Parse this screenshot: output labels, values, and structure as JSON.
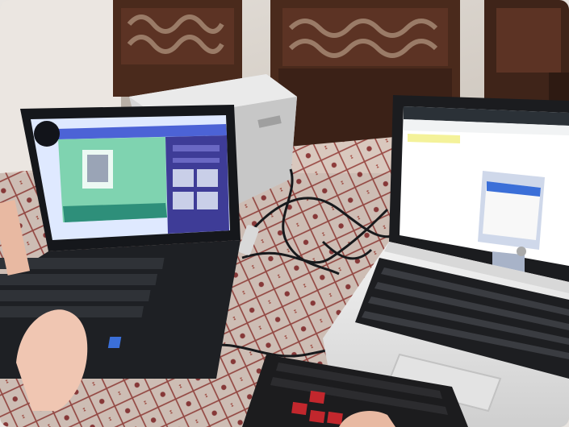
{
  "photo": {
    "scene": "photo",
    "colors": {
      "wall": "#d8d2cb",
      "chair_wood": "#4a2a1c",
      "tablecloth": "#d9c8be",
      "tablecloth_pattern": "#9a4a45",
      "printer": "#d6d6d6",
      "black_laptop": "#15171b",
      "white_laptop": "#eeeeee",
      "left_screen_bg": "#dfe9ff",
      "left_screen_canvas": "#7fd3b0",
      "left_screen_panel": "#3e3c97",
      "right_screen_bg": "#ffffff",
      "right_screen_tab_bar": "#2b3137",
      "keyboard": "#1c1c1e",
      "red_keys": "#c2272d"
    }
  }
}
